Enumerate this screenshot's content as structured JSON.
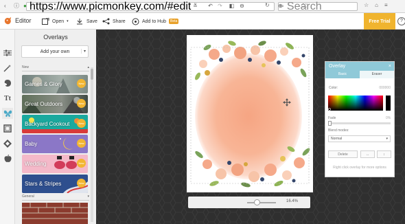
{
  "browser": {
    "url": "https://www.picmonkey.com/#edit",
    "search_placeholder": "Search"
  },
  "header": {
    "app_title": "Editor",
    "open_label": "Open",
    "save_label": "Save",
    "share_label": "Share",
    "hub_label": "Add to Hub",
    "beta_label": "Beta",
    "free_trial_label": "Free Trial"
  },
  "panel": {
    "title": "Overlays",
    "add_own_label": "Add your own",
    "section_new": "New",
    "section_general": "General",
    "new_badge": "New",
    "tiles": [
      {
        "label": "Games & Glory"
      },
      {
        "label": "Great Outdoors"
      },
      {
        "label": "Backyard Cookout"
      },
      {
        "label": "Baby"
      },
      {
        "label": "Wedding"
      },
      {
        "label": "Stars & Stripes"
      }
    ]
  },
  "overlay_dialog": {
    "title": "Overlay",
    "close": "×",
    "tabs": [
      "Basic",
      "Eraser"
    ],
    "active_tab": "Basic",
    "color_label": "Color:",
    "color_value": "000000",
    "fade_label": "Fade",
    "fade_value": "0%",
    "fade_fraction": 0,
    "blend_label": "Blend modes:",
    "blend_value": "Normal",
    "delete_label": "Delete",
    "note": "Right click overlay for more options"
  },
  "zoom": {
    "percent": "16.4%"
  },
  "colors": {
    "accent_teal": "#8fc9d8",
    "free_trial": "#f0b42e",
    "new_badge": "#f2b632",
    "canvas_bg": "#303030"
  }
}
